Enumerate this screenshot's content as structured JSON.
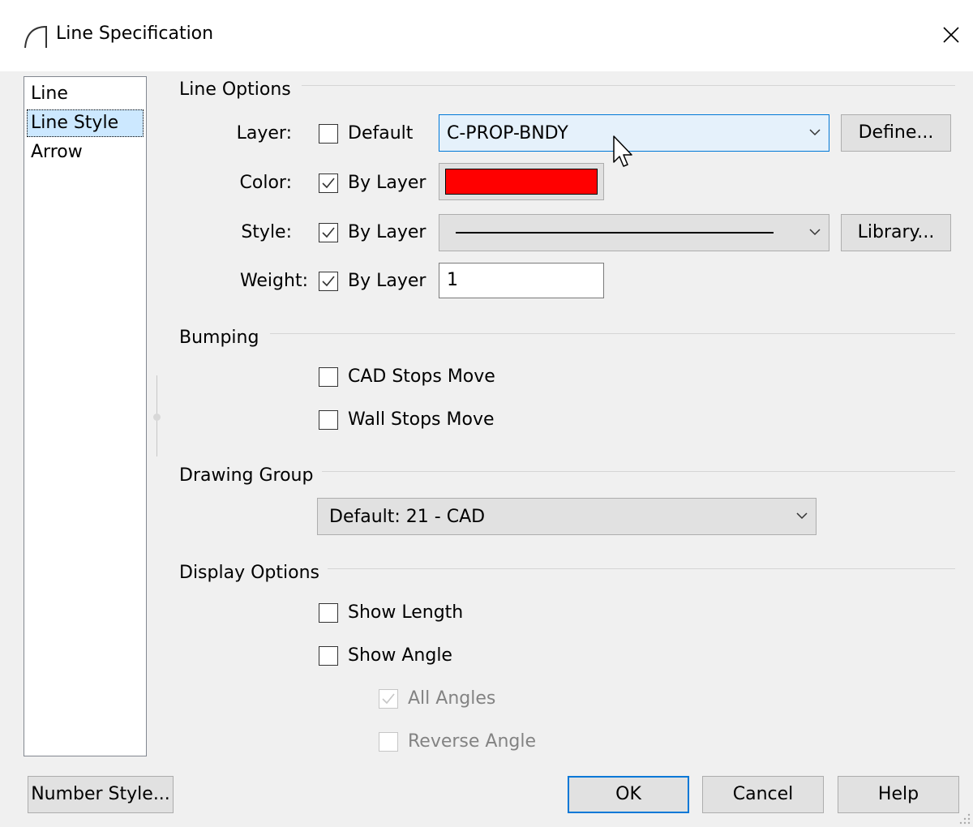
{
  "window": {
    "title": "Line Specification",
    "icon": "arc-icon",
    "close_glyph": "✕"
  },
  "nav": {
    "items": [
      {
        "label": "Line",
        "selected": false
      },
      {
        "label": "Line Style",
        "selected": true
      },
      {
        "label": "Arrow",
        "selected": false
      }
    ]
  },
  "line_options": {
    "header": "Line Options",
    "layer_label": "Layer:",
    "layer_checkbox_label": "Default",
    "layer_checked": false,
    "layer_value": "C-PROP-BNDY",
    "define_button": "Define...",
    "color_label": "Color:",
    "color_checkbox_label": "By Layer",
    "color_checked": true,
    "color_value": "#ff0000",
    "style_label": "Style:",
    "style_checkbox_label": "By Layer",
    "style_checked": true,
    "library_button": "Library...",
    "weight_label": "Weight:",
    "weight_checkbox_label": "By Layer",
    "weight_checked": true,
    "weight_value": "1"
  },
  "bumping": {
    "header": "Bumping",
    "cad_stops_move": {
      "label": "CAD Stops Move",
      "checked": false
    },
    "wall_stops_move": {
      "label": "Wall Stops Move",
      "checked": false
    }
  },
  "drawing_group": {
    "header": "Drawing Group",
    "value": "Default: 21 - CAD"
  },
  "display_options": {
    "header": "Display Options",
    "show_length": {
      "label": "Show Length",
      "checked": false
    },
    "show_angle": {
      "label": "Show Angle",
      "checked": false
    },
    "all_angles": {
      "label": "All Angles",
      "checked": true,
      "disabled": true
    },
    "reverse_angle": {
      "label": "Reverse Angle",
      "checked": false,
      "disabled": true
    }
  },
  "footer": {
    "number_style_button": "Number Style...",
    "ok_button": "OK",
    "cancel_button": "Cancel",
    "help_button": "Help"
  },
  "colors": {
    "accent": "#0078d7",
    "selection": "#cce8ff",
    "dialog_bg": "#f0f0f0"
  }
}
